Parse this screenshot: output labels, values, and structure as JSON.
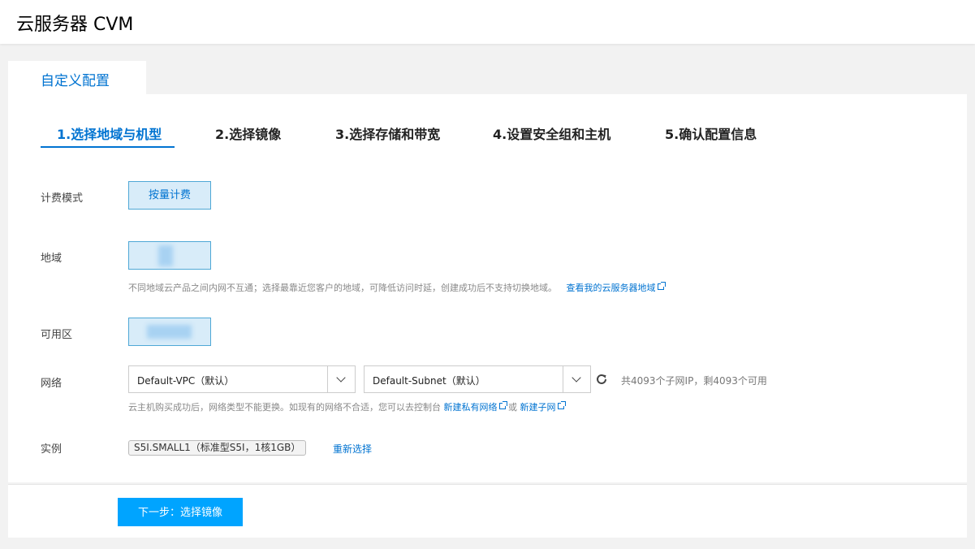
{
  "header": {
    "title": "云服务器 CVM"
  },
  "tab": {
    "label": "自定义配置"
  },
  "steps": [
    {
      "label": "1.选择地域与机型"
    },
    {
      "label": "2.选择镜像"
    },
    {
      "label": "3.选择存储和带宽"
    },
    {
      "label": "4.设置安全组和主机"
    },
    {
      "label": "5.确认配置信息"
    }
  ],
  "billing": {
    "label": "计费模式",
    "option": "按量计费"
  },
  "region": {
    "label": "地域",
    "hint": "不同地域云产品之间内网不互通；选择最靠近您客户的地域，可降低访问时延，创建成功后不支持切换地域。",
    "link": "查看我的云服务器地域"
  },
  "zone": {
    "label": "可用区"
  },
  "network": {
    "label": "网络",
    "vpc": "Default-VPC（默认）",
    "subnet": "Default-Subnet（默认）",
    "ip_info": "共4093个子网IP，剩4093个可用",
    "hint": "云主机购买成功后，网络类型不能更换。如现有的网络不合适，您可以去控制台",
    "link_vpc": "新建私有网络",
    "or": "或",
    "link_subnet": "新建子网"
  },
  "instance": {
    "label": "实例",
    "value": "S5I.SMALL1（标准型S5I，1核1GB）",
    "reselect": "重新选择"
  },
  "footer": {
    "next_label": "下一步：选择镜像"
  },
  "icons": {
    "refresh": "refresh-icon",
    "external": "external-link-icon",
    "dropdown": "chevron-down-icon"
  },
  "colors": {
    "accent": "#0073d1",
    "primary_button": "#00a4ff",
    "chip_bg": "#d8ecf9"
  }
}
